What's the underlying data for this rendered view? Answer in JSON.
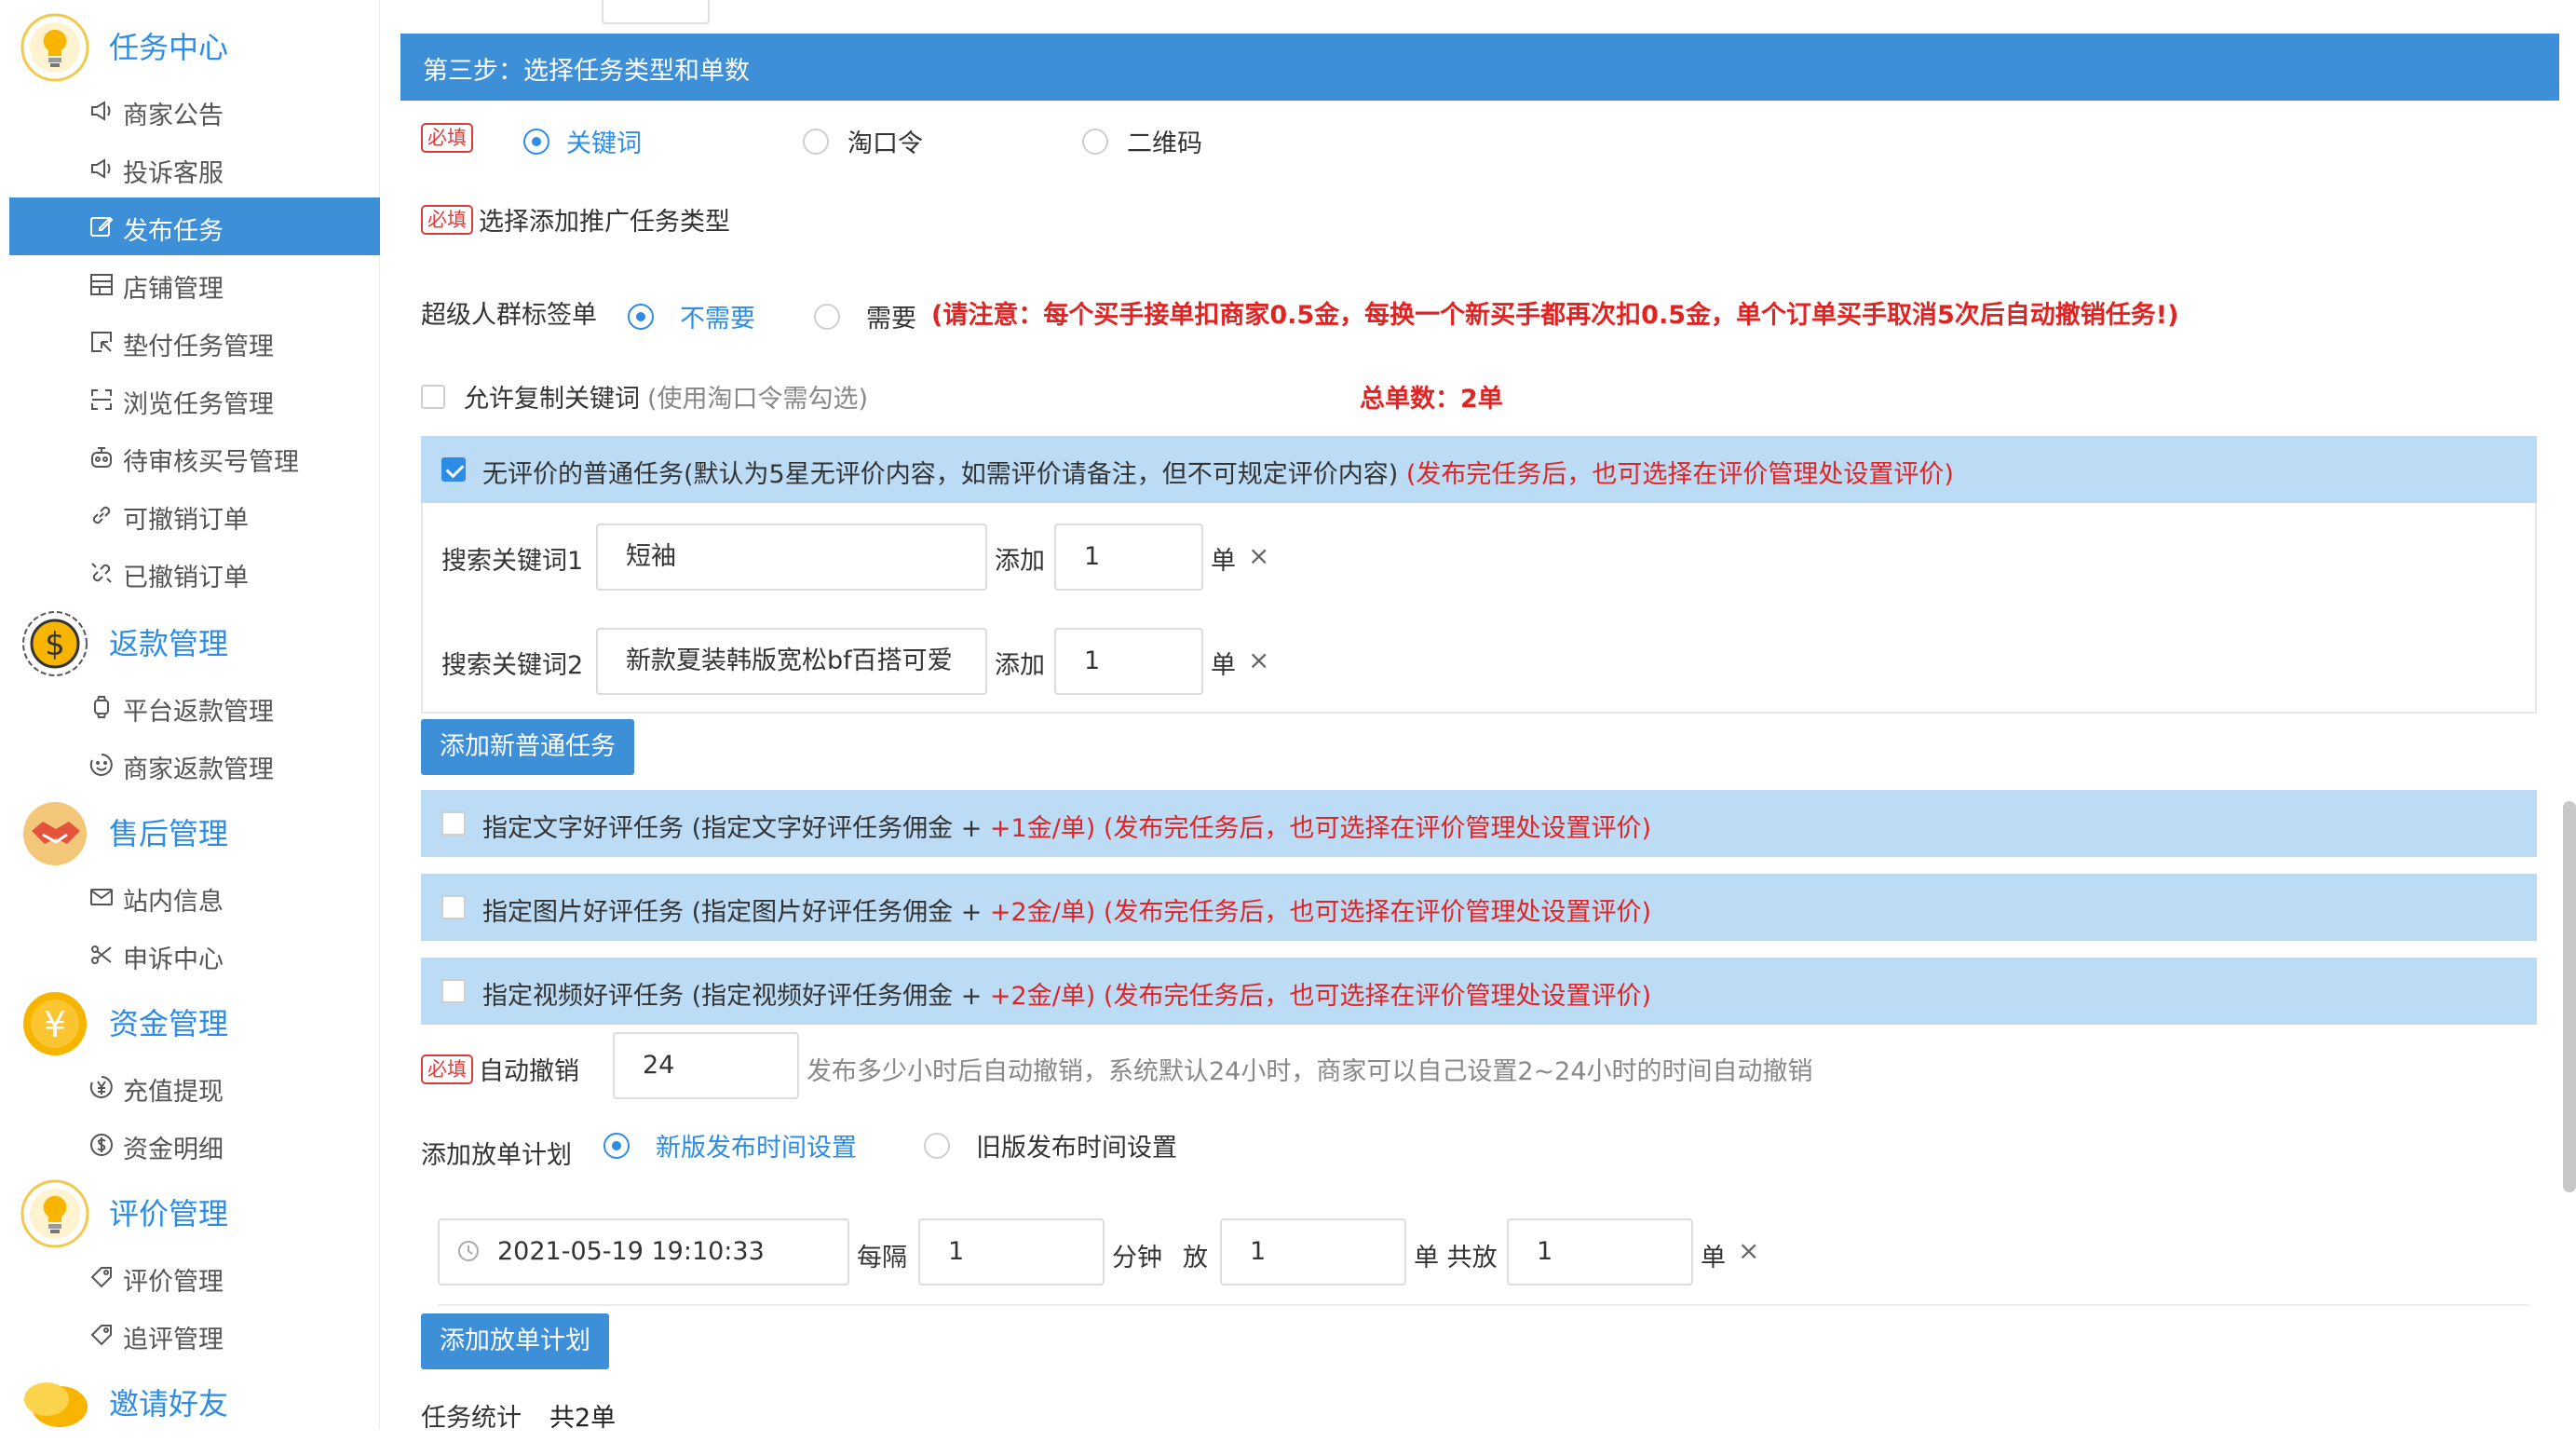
{
  "sidebar": {
    "groups": [
      {
        "title": "任务中心",
        "icon": "lightbulb-icon",
        "items": [
          {
            "label": "商家公告",
            "icon": "megaphone-icon"
          },
          {
            "label": "投诉客服",
            "icon": "megaphone-icon"
          },
          {
            "label": "发布任务",
            "icon": "edit-icon",
            "active": true
          },
          {
            "label": "店铺管理",
            "icon": "store-icon"
          },
          {
            "label": "垫付任务管理",
            "icon": "cursor-box-icon"
          },
          {
            "label": "浏览任务管理",
            "icon": "scan-icon"
          },
          {
            "label": "待审核买号管理",
            "icon": "robot-icon"
          },
          {
            "label": "可撤销订单",
            "icon": "link-icon"
          },
          {
            "label": "已撤销订单",
            "icon": "unlink-icon"
          }
        ]
      },
      {
        "title": "返款管理",
        "icon": "dollar-coin-icon",
        "items": [
          {
            "label": "平台返款管理",
            "icon": "watch-icon"
          },
          {
            "label": "商家返款管理",
            "icon": "smile-icon"
          }
        ]
      },
      {
        "title": "售后管理",
        "icon": "handshake-icon",
        "items": [
          {
            "label": "站内信息",
            "icon": "mail-icon"
          },
          {
            "label": "申诉中心",
            "icon": "scissors-icon"
          }
        ]
      },
      {
        "title": "资金管理",
        "icon": "yen-coin-icon",
        "items": [
          {
            "label": "充值提现",
            "icon": "yen-circle-icon"
          },
          {
            "label": "资金明细",
            "icon": "dollar-circle-icon"
          }
        ]
      },
      {
        "title": "评价管理",
        "icon": "lightbulb-icon",
        "items": [
          {
            "label": "评价管理",
            "icon": "tag-icon"
          },
          {
            "label": "追评管理",
            "icon": "tag-icon"
          }
        ]
      },
      {
        "title": "邀请好友",
        "icon": "chat-bubble-icon",
        "items": []
      }
    ]
  },
  "step": {
    "title": "第三步：选择任务类型和单数"
  },
  "required": "必填",
  "task_type": {
    "options": [
      "关键词",
      "淘口令",
      "二维码"
    ],
    "selected": "关键词"
  },
  "promo_label": "选择添加推广任务类型",
  "super_tag": {
    "label": "超级人群标签单",
    "opt_no": "不需要",
    "opt_yes": "需要",
    "notice": "(请注意：每个买手接单扣商家0.5金，每换一个新买手都再次扣0.5金，单个订单买手取消5次后自动撤销任务!)"
  },
  "copy_kw": {
    "label": "允许复制关键词",
    "hint": "(使用淘口令需勾选)",
    "total": "总单数：2单"
  },
  "normal_task": {
    "label": "无评价的普通任务(默认为5星无评价内容，如需评价请备注，但不可规定评价内容)",
    "note": "(发布完任务后，也可选择在评价管理处设置评价)",
    "rows": [
      {
        "label": "搜索关键词1",
        "keyword": "短袖",
        "add": "添加",
        "qty": "1",
        "unit": "单"
      },
      {
        "label": "搜索关键词2",
        "keyword": "新款夏装韩版宽松bf百搭可爱",
        "add": "添加",
        "qty": "1",
        "unit": "单"
      }
    ],
    "add_button": "添加新普通任务"
  },
  "review_tasks": [
    {
      "label": "指定文字好评任务 (指定文字好评任务佣金 + ",
      "fee": "+1金/单) (发布完任务后，也可选择在评价管理处设置评价)"
    },
    {
      "label": "指定图片好评任务 (指定图片好评任务佣金 + ",
      "fee": "+2金/单) (发布完任务后，也可选择在评价管理处设置评价)"
    },
    {
      "label": "指定视频好评任务 (指定视频好评任务佣金 + ",
      "fee": "+2金/单) (发布完任务后，也可选择在评价管理处设置评价)"
    }
  ],
  "auto_cancel": {
    "label": "自动撤销",
    "value": "24",
    "hint": "发布多少小时后自动撤销，系统默认24小时，商家可以自己设置2~24小时的时间自动撤销"
  },
  "plan": {
    "label": "添加放单计划",
    "opt_new": "新版发布时间设置",
    "opt_old": "旧版发布时间设置",
    "datetime": "2021-05-19 19:10:33",
    "every": "每隔",
    "interval": "1",
    "minute": "分钟",
    "put": "放",
    "count": "1",
    "unit_total": "单 共放",
    "total": "1",
    "unit": "单",
    "add_button": "添加放单计划"
  },
  "summary": {
    "label": "任务统计",
    "value": "共2单"
  },
  "colors": {
    "accent": "#3d8fd7",
    "text_blue": "#2d8ce6",
    "warning": "#e02424",
    "band": "#bcdcf6"
  }
}
